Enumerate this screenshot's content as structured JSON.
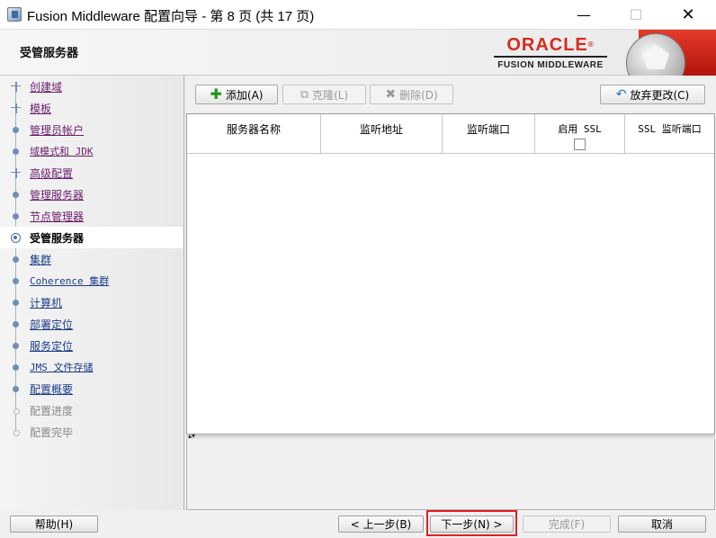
{
  "window": {
    "title": "Fusion Middleware 配置向导 - 第 8 页 (共 17 页)",
    "minimize_symbol": "—",
    "maximize_symbol": "☐",
    "close_symbol": "✕"
  },
  "header": {
    "page_title": "受管服务器",
    "logo_word": "ORACLE",
    "logo_reg": "®",
    "logo_subtitle": "FUSION MIDDLEWARE",
    "brand_color": "#d52b1e"
  },
  "sidebar": {
    "items": [
      {
        "label": "创建域",
        "state": "visited"
      },
      {
        "label": "模板",
        "state": "visited"
      },
      {
        "label": "管理员帐户",
        "state": "visited"
      },
      {
        "label": "域模式和 JDK",
        "state": "visited"
      },
      {
        "label": "高级配置",
        "state": "visited"
      },
      {
        "label": "管理服务器",
        "state": "visited"
      },
      {
        "label": "节点管理器",
        "state": "visited"
      },
      {
        "label": "受管服务器",
        "state": "current"
      },
      {
        "label": "集群",
        "state": "link"
      },
      {
        "label": "Coherence 集群",
        "state": "link"
      },
      {
        "label": "计算机",
        "state": "link"
      },
      {
        "label": "部署定位",
        "state": "link"
      },
      {
        "label": "服务定位",
        "state": "link"
      },
      {
        "label": "JMS 文件存储",
        "state": "link"
      },
      {
        "label": "配置概要",
        "state": "link"
      },
      {
        "label": "配置进度",
        "state": "disabled"
      },
      {
        "label": "配置完毕",
        "state": "disabled"
      }
    ]
  },
  "toolbar": {
    "add_label": "添加(A)",
    "clone_label": "克隆(L)",
    "delete_label": "删除(D)",
    "revert_label": "放弃更改(C)"
  },
  "table": {
    "columns": [
      "服务器名称",
      "监听地址",
      "监听端口",
      "启用 SSL",
      "SSL 监听端口"
    ],
    "rows": []
  },
  "footer": {
    "help_label": "帮助(H)",
    "back_label": "< 上一步(B)",
    "next_label": "下一步(N) >",
    "finish_label": "完成(F)",
    "cancel_label": "取消"
  }
}
